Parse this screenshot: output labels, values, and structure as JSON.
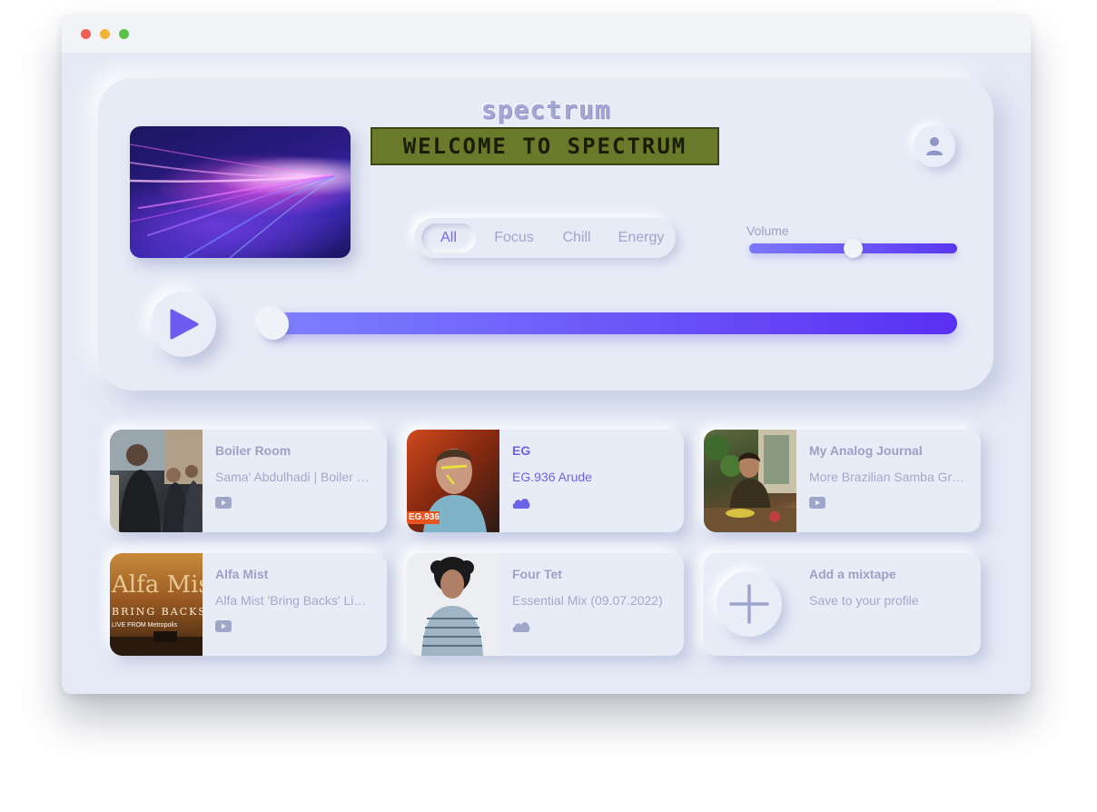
{
  "app": {
    "logo": "spectrum",
    "lcd_text": "WELCOME TO SPECTRUM"
  },
  "filters": [
    {
      "label": "All",
      "active": true
    },
    {
      "label": "Focus",
      "active": false
    },
    {
      "label": "Chill",
      "active": false
    },
    {
      "label": "Energy",
      "active": false
    }
  ],
  "volume": {
    "label": "Volume",
    "level": 0.5
  },
  "seek": {
    "progress": 0.0
  },
  "colors": {
    "accent": "#6d63e8",
    "track_start": "#7d80ff",
    "track_end": "#5a2ff2",
    "background": "#e4e9f5"
  },
  "mixtapes": [
    {
      "title": "Boiler Room",
      "subtitle": "Sama' Abdulhadi | Boiler Room",
      "icon": "youtube-icon",
      "featured": false
    },
    {
      "title": "EG",
      "subtitle": "EG.936 Arude",
      "icon": "soundcloud-icon",
      "featured": true,
      "badge": "EG.936"
    },
    {
      "title": "My Analog Journal",
      "subtitle": "More Brazilian Samba Groove",
      "icon": "youtube-icon",
      "featured": false
    },
    {
      "title": "Alfa Mist",
      "subtitle": "Alfa Mist 'Bring Backs' Live at Metropolis",
      "icon": "youtube-icon",
      "featured": false,
      "thumb_text": "Alfa Mist",
      "thumb_caption": "BRING BACKS",
      "thumb_footer": "LIVE FROM Metropolis"
    },
    {
      "title": "Four Tet",
      "subtitle": "Essential Mix (09.07.2022)",
      "icon": "soundcloud-icon",
      "featured": false
    }
  ],
  "add_card": {
    "title": "Add a mixtape",
    "subtitle": "Save to your profile",
    "icon": "plus-icon"
  }
}
